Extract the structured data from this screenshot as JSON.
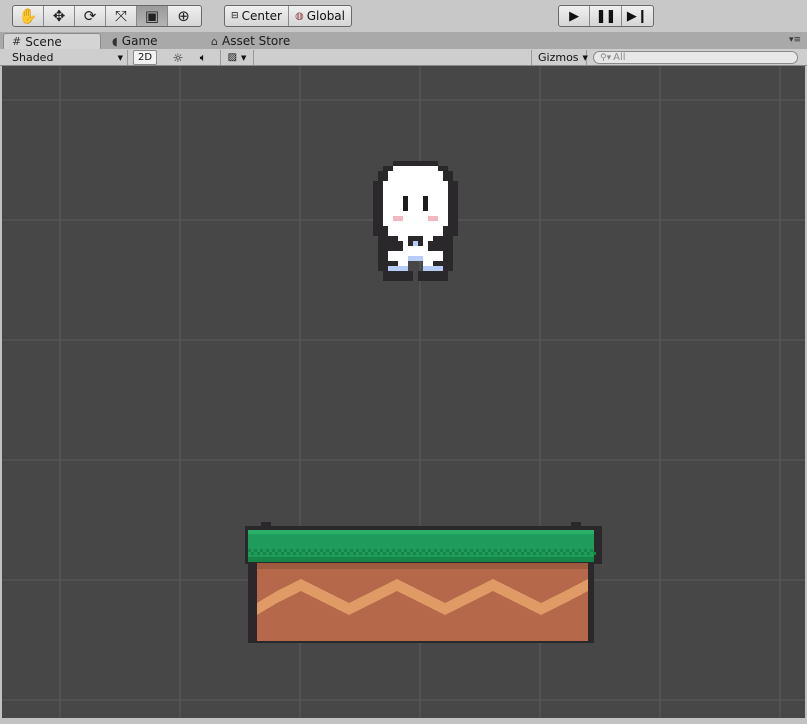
{
  "toolbar": {
    "transform_tools": [
      {
        "name": "hand-tool",
        "icon": "hand-icon",
        "glyph": "✋",
        "active": false
      },
      {
        "name": "move-tool",
        "icon": "move-icon",
        "glyph": "✥",
        "active": false
      },
      {
        "name": "rotate-tool",
        "icon": "rotate-icon",
        "glyph": "⟳",
        "active": false
      },
      {
        "name": "scale-tool",
        "icon": "scale-icon",
        "glyph": "⤧",
        "active": false
      },
      {
        "name": "rect-tool",
        "icon": "rect-transform-icon",
        "glyph": "▣",
        "active": true
      },
      {
        "name": "combined-tool",
        "icon": "transform-all-icon",
        "glyph": "⊕",
        "active": false
      }
    ],
    "pivot_label": "Center",
    "pivot_icon": "center-pivot-icon",
    "rotation_label": "Global",
    "rotation_icon": "globe-icon",
    "play_icon": "play-icon",
    "pause_icon": "pause-icon",
    "step_icon": "step-icon"
  },
  "tabs": [
    {
      "label": "Scene",
      "icon": "grid-icon",
      "active": true
    },
    {
      "label": "Game",
      "icon": "pacman-icon",
      "active": false
    },
    {
      "label": "Asset Store",
      "icon": "store-icon",
      "active": false
    }
  ],
  "scene_toolbar": {
    "draw_mode": "Shaded",
    "mode_2d": "2D",
    "lighting_icon": "sun-icon",
    "audio_icon": "speaker-icon",
    "effects_icon": "image-icon",
    "gizmos_label": "Gizmos",
    "search_placeholder": "All",
    "search_icon": "search-icon"
  },
  "colors": {
    "scene_bg": "#474747",
    "grid_line": "#5b5b5b",
    "grass": "#1f9c5c",
    "grass_dark": "#168548",
    "dirt": "#b5694a",
    "dirt_light": "#e09a66",
    "outline": "#2b282c",
    "character_body": "#ffffff",
    "blush": "#f3b7c1",
    "shoe_blue": "#b8cdf5"
  }
}
